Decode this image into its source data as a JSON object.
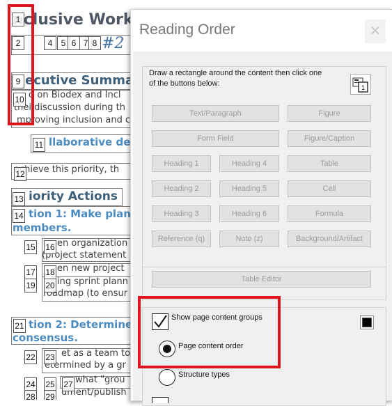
{
  "document": {
    "title": "nclusive Work",
    "handwriting": "#2",
    "exec_summary": "ecutive Summar",
    "para1_l1": "d on Biodex and Incl",
    "para1_l2": "thei discussion during th",
    "para1_l3": "mproving inclusion and c",
    "collab": "llaborative dec",
    "achieve": "achieve this priority, th",
    "priority_actions": "iority Actions",
    "action1_l1": "tion 1: Make plann",
    "action1_l2": "members.",
    "b15_l1": "en organization",
    "b15_l2": "(project statement",
    "b17": "en new project",
    "b19_l1": "ing sprint plann",
    "b19_l2": "roadmap (to ensur",
    "action2_l1": "tion 2: Determine",
    "action2_l2": "consensus.",
    "b22_l1": "et as a team to i",
    "b22_l2": "etermined by a gr",
    "b24_l1": "what \"grou",
    "b24_l2": "ument/publish",
    "tags": [
      "1",
      "2",
      "4",
      "5",
      "6",
      "7",
      "8",
      "9",
      "10",
      "11",
      "12",
      "13",
      "14",
      "15",
      "16",
      "17",
      "18",
      "19",
      "20",
      "21",
      "22",
      "23",
      "24",
      "25",
      "27",
      "28",
      "29"
    ]
  },
  "dialog": {
    "title": "Reading Order",
    "close_icon": "close-icon",
    "instructions": "Draw a rectangle around the content then click one of the buttons below:",
    "buttons": {
      "text_paragraph": "Text/Paragraph",
      "figure": "Figure",
      "form_field": "Form Field",
      "figure_caption": "Figure/Caption",
      "heading1": "Heading 1",
      "heading4": "Heading 4",
      "table": "Table",
      "heading2": "Heading 2",
      "heading5": "Heading 5",
      "cell": "Cell",
      "heading3": "Heading 3",
      "heading6": "Heading 6",
      "formula": "Formula",
      "reference": "Reference (q)",
      "note": "Note (z)",
      "background_artifact": "Background/Artifact",
      "table_editor": "Table Editor"
    },
    "show_page_content_groups": "Show page content groups",
    "page_content_order": "Page content order",
    "structure_types": "Structure types",
    "colors": {
      "highlight_red": "#e0141e",
      "swatch": "#000000"
    }
  }
}
